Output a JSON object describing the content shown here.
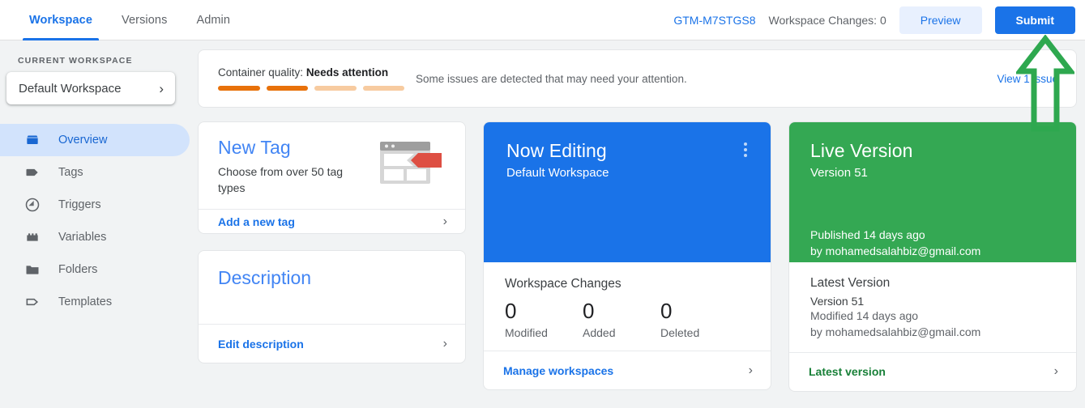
{
  "header": {
    "tabs": [
      {
        "label": "Workspace",
        "active": true
      },
      {
        "label": "Versions",
        "active": false
      },
      {
        "label": "Admin",
        "active": false
      }
    ],
    "container_id": "GTM-M7STGS8",
    "workspace_changes": "Workspace Changes: 0",
    "preview_label": "Preview",
    "submit_label": "Submit"
  },
  "sidebar": {
    "section_label": "CURRENT WORKSPACE",
    "workspace_name": "Default Workspace",
    "chevron": "›",
    "items": [
      {
        "label": "Overview",
        "icon": "overview-icon",
        "active": true
      },
      {
        "label": "Tags",
        "icon": "tag-icon",
        "active": false
      },
      {
        "label": "Triggers",
        "icon": "trigger-icon",
        "active": false
      },
      {
        "label": "Variables",
        "icon": "variable-icon",
        "active": false
      },
      {
        "label": "Folders",
        "icon": "folder-icon",
        "active": false
      },
      {
        "label": "Templates",
        "icon": "template-icon",
        "active": false
      }
    ]
  },
  "banner": {
    "title_prefix": "Container quality: ",
    "status": "Needs attention",
    "message": "Some issues are detected that may need your attention.",
    "link": "View 1 issue",
    "bars": [
      {
        "filled": true,
        "color": "#E8710A"
      },
      {
        "filled": true,
        "color": "#E8710A"
      },
      {
        "filled": false,
        "color": "#F7CBA0"
      },
      {
        "filled": false,
        "color": "#F7CBA0"
      }
    ]
  },
  "cards": {
    "new_tag": {
      "title": "New Tag",
      "subtitle": "Choose from over 50 tag types",
      "footer_label": "Add a new tag",
      "chevron": "›",
      "illustration": "browser-tag-illustration"
    },
    "description": {
      "title": "Description",
      "footer_label": "Edit description",
      "chevron": "›"
    },
    "now_editing": {
      "title": "Now Editing",
      "subtitle": "Default Workspace",
      "menu_icon": "kebab-menu-icon",
      "changes_title": "Workspace Changes",
      "counts": [
        {
          "value": "0",
          "label": "Modified"
        },
        {
          "value": "0",
          "label": "Added"
        },
        {
          "value": "0",
          "label": "Deleted"
        }
      ],
      "footer_label": "Manage workspaces",
      "chevron": "›"
    },
    "live_version": {
      "title": "Live Version",
      "subtitle": "Version 51",
      "published": "Published 14 days ago",
      "published_by": "by mohamedsalahbiz@gmail.com",
      "latest_title": "Latest Version",
      "latest_version": "Version 51",
      "latest_modified": "Modified 14 days ago",
      "latest_by": "by mohamedsalahbiz@gmail.com",
      "footer_label": "Latest version",
      "chevron": "›"
    }
  },
  "annotation": {
    "shape": "up-arrow-annotation",
    "color": "#2EA84F"
  },
  "colors": {
    "accent_blue": "#1a73e8",
    "live_green": "#34a853",
    "warn_orange": "#E8710A",
    "page_bg": "#f1f3f4"
  }
}
